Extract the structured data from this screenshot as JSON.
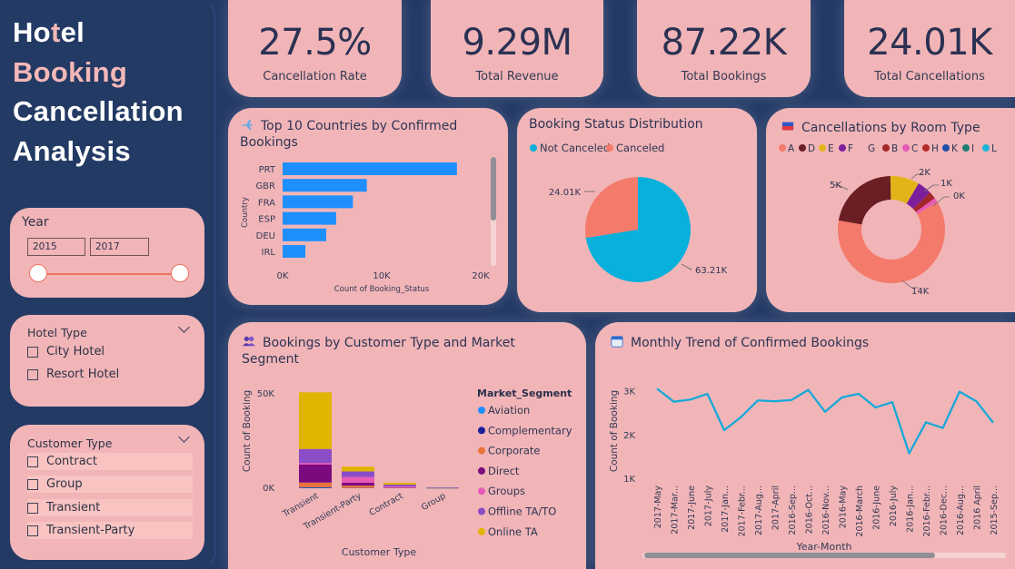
{
  "title": {
    "lines": [
      [
        {
          "t": "Ho",
          "c": "w"
        },
        {
          "t": "t",
          "c": "p"
        },
        {
          "t": "el",
          "c": "w"
        }
      ],
      [
        {
          "t": "Booking",
          "c": "p"
        }
      ],
      [
        {
          "t": "Cancellation",
          "c": "w"
        }
      ],
      [
        {
          "t": "Analysis",
          "c": "w"
        }
      ]
    ]
  },
  "filters": {
    "year": {
      "label": "Year",
      "from": "2015",
      "to": "2017"
    },
    "hotel_type": {
      "label": "Hotel Type",
      "options": [
        "City Hotel",
        "Resort Hotel"
      ]
    },
    "customer_type": {
      "label": "Customer Type",
      "options": [
        "Contract",
        "Group",
        "Transient",
        "Transient-Party"
      ]
    }
  },
  "kpis": [
    {
      "value": "27.5%",
      "label": "Cancellation Rate"
    },
    {
      "value": "9.29M",
      "label": "Total Revenue"
    },
    {
      "value": "87.22K",
      "label": "Total Bookings"
    },
    {
      "value": "24.01K",
      "label": "Total Cancellations"
    }
  ],
  "colors": {
    "bar_blue": "#1f8fff",
    "pie_blue": "#08b0dc",
    "salmon": "#f47a6b",
    "card": "#f1b5b8",
    "bg": "#243a66",
    "line": "#16a9d9"
  },
  "chart_data": [
    {
      "id": "countries",
      "type": "bar",
      "orientation": "horizontal",
      "title": "Top 10 Countries by Confirmed Bookings",
      "xlabel": "Count of Booking_Status",
      "ylabel": "Country",
      "categories": [
        "PRT",
        "GBR",
        "FRA",
        "ESP",
        "DEU",
        "IRL"
      ],
      "values": [
        17600,
        8500,
        7100,
        5400,
        4400,
        2300
      ],
      "xlim": [
        0,
        20000
      ],
      "xticks": [
        "0K",
        "10K",
        "20K"
      ]
    },
    {
      "id": "status",
      "type": "pie",
      "title": "Booking Status Distribution",
      "legend": [
        "Not Canceled",
        "Canceled"
      ],
      "slices": [
        {
          "name": "Not Canceled",
          "value": 63.21,
          "label": "63.21K"
        },
        {
          "name": "Canceled",
          "value": 24.01,
          "label": "24.01K"
        }
      ]
    },
    {
      "id": "room",
      "type": "pie",
      "donut": true,
      "title": "Cancellations by Room Type",
      "legend": [
        "A",
        "D",
        "E",
        "F",
        "G",
        "B",
        "C",
        "H",
        "K",
        "I",
        "L"
      ],
      "legend_colors": [
        "#f47a6b",
        "#6b1e24",
        "#e3b41a",
        "#7d1f9d",
        "#f1b5b8",
        "#a3262a",
        "#e85ab8",
        "#b32a2a",
        "#214da8",
        "#1a7e70",
        "#1ab3d6"
      ],
      "slices": [
        {
          "name": "A",
          "value": 14000,
          "label": "14K"
        },
        {
          "name": "D",
          "value": 5000,
          "label": "5K"
        },
        {
          "name": "E",
          "value": 2000,
          "label": "2K"
        },
        {
          "name": "F",
          "value": 1000,
          "label": "1K"
        },
        {
          "name": "B",
          "value": 500,
          "label": ""
        },
        {
          "name": "C",
          "value": 300,
          "label": "0K"
        }
      ]
    },
    {
      "id": "segment",
      "type": "bar",
      "stacked": true,
      "title": "Bookings by Customer Type and Market Segment",
      "xlabel": "Customer Type",
      "ylabel": "Count of Booking",
      "legend_title": "Market_Segment",
      "categories": [
        "Transient",
        "Transient-Party",
        "Contract",
        "Group"
      ],
      "yticks": [
        "0K",
        "50K"
      ],
      "ylim": [
        0,
        50000
      ],
      "series": [
        {
          "name": "Aviation",
          "color": "#1f8fff",
          "values": [
            200,
            100,
            0,
            0
          ]
        },
        {
          "name": "Complementary",
          "color": "#1a1e9a",
          "values": [
            300,
            100,
            0,
            0
          ]
        },
        {
          "name": "Corporate",
          "color": "#e8743b",
          "values": [
            2500,
            1200,
            100,
            0
          ]
        },
        {
          "name": "Direct",
          "color": "#7b0a7f",
          "values": [
            9500,
            1500,
            200,
            0
          ]
        },
        {
          "name": "Groups",
          "color": "#e85ab8",
          "values": [
            800,
            3000,
            600,
            300
          ]
        },
        {
          "name": "Offline TA/TO",
          "color": "#8b4cc8",
          "values": [
            7500,
            3000,
            1000,
            200
          ]
        },
        {
          "name": "Online TA",
          "color": "#e0b400",
          "values": [
            30000,
            2500,
            1000,
            0
          ]
        }
      ]
    },
    {
      "id": "monthly",
      "type": "line",
      "title": "Monthly Trend of Confirmed Bookings",
      "xlabel": "Year-Month",
      "ylabel": "Count of Booking",
      "yticks": [
        "1K",
        "2K",
        "3K"
      ],
      "ylim": [
        1000,
        3200
      ],
      "x": [
        "2017-May",
        "2017-Mar...",
        "2017-June",
        "2017-July",
        "2017-Jan...",
        "2017-Febr...",
        "2017-Aug...",
        "2017-April",
        "2016-Sep...",
        "2016-Oct...",
        "2016-Nov...",
        "2016-May",
        "2016-March",
        "2016-June",
        "2016-July",
        "2016-Jan...",
        "2016-Febr...",
        "2016-Dec...",
        "2016-Aug...",
        "2016 April",
        "2015-Sep..."
      ],
      "values": [
        3050,
        2750,
        2800,
        2930,
        2100,
        2400,
        2780,
        2760,
        2790,
        3020,
        2520,
        2850,
        2930,
        2620,
        2740,
        1570,
        2280,
        2150,
        2980,
        2760,
        2270
      ]
    }
  ]
}
